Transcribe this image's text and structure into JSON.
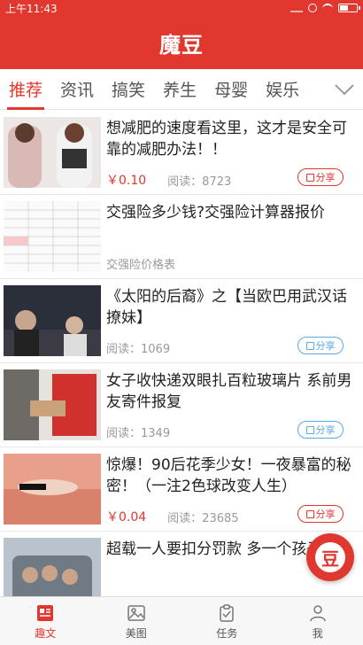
{
  "status_bar": {
    "time": "上午11:43"
  },
  "app": {
    "logo": "魔豆"
  },
  "tabs": [
    {
      "label": "推荐",
      "active": true
    },
    {
      "label": "资讯",
      "active": false
    },
    {
      "label": "搞笑",
      "active": false
    },
    {
      "label": "养生",
      "active": false
    },
    {
      "label": "母婴",
      "active": false
    },
    {
      "label": "娱乐",
      "active": false
    }
  ],
  "feed": [
    {
      "title": "想减肥的速度看这里，这才是安全可靠的减肥办法！！",
      "price": "￥0.10",
      "reads": "阅读：8723",
      "share": "分享",
      "share_style": "red"
    },
    {
      "title": "交强险多少钱?交强险计算器报价",
      "tag": "交强险价格表"
    },
    {
      "title": "《太阳的后裔》之【当欧巴用武汉话撩妹】",
      "reads": "阅读：1069",
      "share": "分享",
      "share_style": "blue"
    },
    {
      "title": "女子收快递双眼扎百粒玻璃片 系前男友寄件报复",
      "reads": "阅读：1349",
      "share": "分享",
      "share_style": "blue"
    },
    {
      "title": "惊爆！90后花季少女！一夜暴富的秘密！（一注2色球改变人生）",
      "price": "￥0.04",
      "reads": "阅读：23685",
      "share": "分享",
      "share_style": "red"
    },
    {
      "title": "超载一人要扣分罚款 多一个孩子吗"
    }
  ],
  "fab": {
    "glyph": "豆"
  },
  "bottom_nav": [
    {
      "label": "趣文",
      "active": true,
      "icon": "article-icon"
    },
    {
      "label": "美图",
      "active": false,
      "icon": "image-icon"
    },
    {
      "label": "任务",
      "active": false,
      "icon": "task-icon"
    },
    {
      "label": "我",
      "active": false,
      "icon": "person-icon"
    }
  ],
  "colors": {
    "brand": "#e0372e",
    "share_blue": "#5aa8e6"
  }
}
